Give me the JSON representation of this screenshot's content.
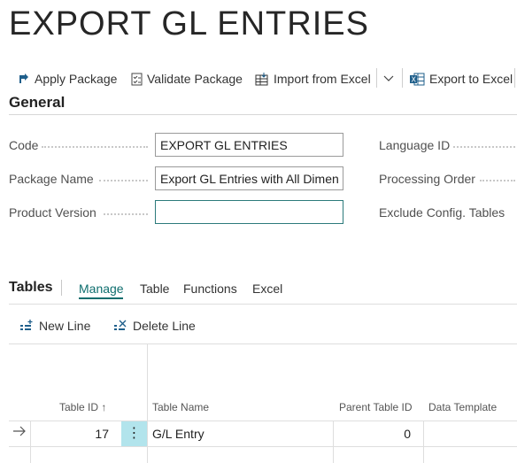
{
  "page": {
    "title": "EXPORT GL ENTRIES"
  },
  "actions": {
    "apply_package": "Apply Package",
    "validate_package": "Validate Package",
    "import_from_excel": "Import from Excel",
    "export_to_excel": "Export to Excel"
  },
  "general": {
    "heading": "General",
    "code_label": "Code",
    "code_value": "EXPORT GL ENTRIES",
    "package_name_label": "Package Name",
    "package_name_value": "Export GL Entries with All Dimens",
    "product_version_label": "Product Version",
    "product_version_value": "",
    "language_id_label": "Language ID",
    "processing_order_label": "Processing Order",
    "exclude_config_label": "Exclude Config. Tables"
  },
  "tables": {
    "heading": "Tables",
    "tabs": [
      "Manage",
      "Table",
      "Functions",
      "Excel"
    ],
    "new_line": "New Line",
    "delete_line": "Delete Line",
    "columns": {
      "table_id": "Table ID ↑",
      "table_name": "Table Name",
      "parent_table_id": "Parent Table ID",
      "data_template": "Data Template"
    },
    "rows": [
      {
        "table_id": "17",
        "menu": "⋮",
        "table_name": "G/L Entry",
        "parent_table_id": "0",
        "data_template": ""
      }
    ]
  },
  "colors": {
    "accent": "#0e6e6e",
    "selected_cell": "#b2e4ec"
  }
}
